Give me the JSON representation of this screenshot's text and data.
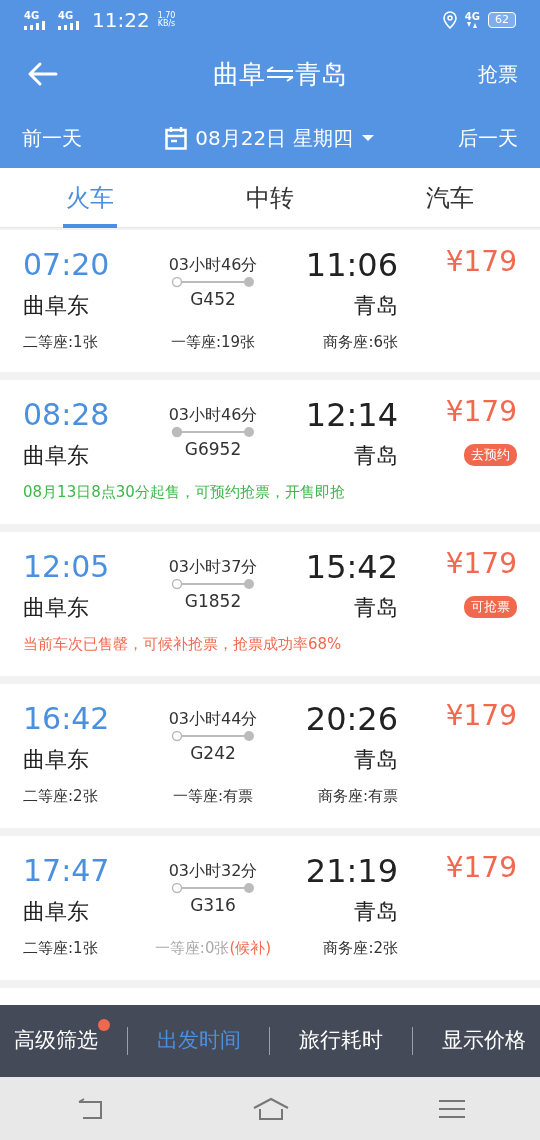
{
  "status_bar": {
    "signals": [
      {
        "label": "4G"
      },
      {
        "label": "4G"
      }
    ],
    "time": "11:22",
    "speed_value": "1.70",
    "speed_unit": "KB/s",
    "network": "4G",
    "battery": "62"
  },
  "header": {
    "from": "曲阜",
    "to": "青岛",
    "action": "抢票"
  },
  "date_bar": {
    "prev": "前一天",
    "date": "08月22日 星期四",
    "next": "后一天"
  },
  "tabs": [
    {
      "label": "火车",
      "selected": true
    },
    {
      "label": "中转",
      "selected": false
    },
    {
      "label": "汽车",
      "selected": false
    }
  ],
  "trains": [
    {
      "depart_time": "07:20",
      "depart_station": "曲阜东",
      "duration": "03小时46分",
      "train_no": "G452",
      "origin_start": true,
      "arrive_time": "11:06",
      "arrive_station": "青岛",
      "price": "¥179",
      "seats": [
        {
          "text": "二等座:1张",
          "sold_out": false
        },
        {
          "text": "一等座:19张",
          "sold_out": false
        },
        {
          "text": "商务座:6张",
          "sold_out": false
        }
      ]
    },
    {
      "depart_time": "08:28",
      "depart_station": "曲阜东",
      "duration": "03小时46分",
      "train_no": "G6952",
      "origin_start": false,
      "arrive_time": "12:14",
      "arrive_station": "青岛",
      "price": "¥179",
      "badge": "去预约",
      "notice": {
        "text": "08月13日8点30分起售，可预约抢票，开售即抢",
        "color": "#3db64a"
      }
    },
    {
      "depart_time": "12:05",
      "depart_station": "曲阜东",
      "duration": "03小时37分",
      "train_no": "G1852",
      "origin_start": true,
      "arrive_time": "15:42",
      "arrive_station": "青岛",
      "price": "¥179",
      "badge": "可抢票",
      "notice": {
        "text": "当前车次已售罄，可候补抢票，抢票成功率68%",
        "color": "#f0694e"
      }
    },
    {
      "depart_time": "16:42",
      "depart_station": "曲阜东",
      "duration": "03小时44分",
      "train_no": "G242",
      "origin_start": true,
      "arrive_time": "20:26",
      "arrive_station": "青岛",
      "price": "¥179",
      "seats": [
        {
          "text": "二等座:2张",
          "sold_out": false
        },
        {
          "text": "一等座:有票",
          "sold_out": false
        },
        {
          "text": "商务座:有票",
          "sold_out": false
        }
      ]
    },
    {
      "depart_time": "17:47",
      "depart_station": "曲阜东",
      "duration": "03小时32分",
      "train_no": "G316",
      "origin_start": true,
      "arrive_time": "21:19",
      "arrive_station": "青岛",
      "price": "¥179",
      "seats": [
        {
          "text": "二等座:1张",
          "sold_out": false
        },
        {
          "text": "一等座:0张",
          "sold_out": true,
          "note": "(候补)"
        },
        {
          "text": "商务座:2张",
          "sold_out": false
        }
      ]
    }
  ],
  "sort_bar": [
    {
      "label": "高级筛选",
      "selected": false,
      "dot": true
    },
    {
      "label": "出发时间",
      "selected": true,
      "dot": false
    },
    {
      "label": "旅行耗时",
      "selected": false,
      "dot": false
    },
    {
      "label": "显示价格",
      "selected": false,
      "dot": false
    }
  ]
}
